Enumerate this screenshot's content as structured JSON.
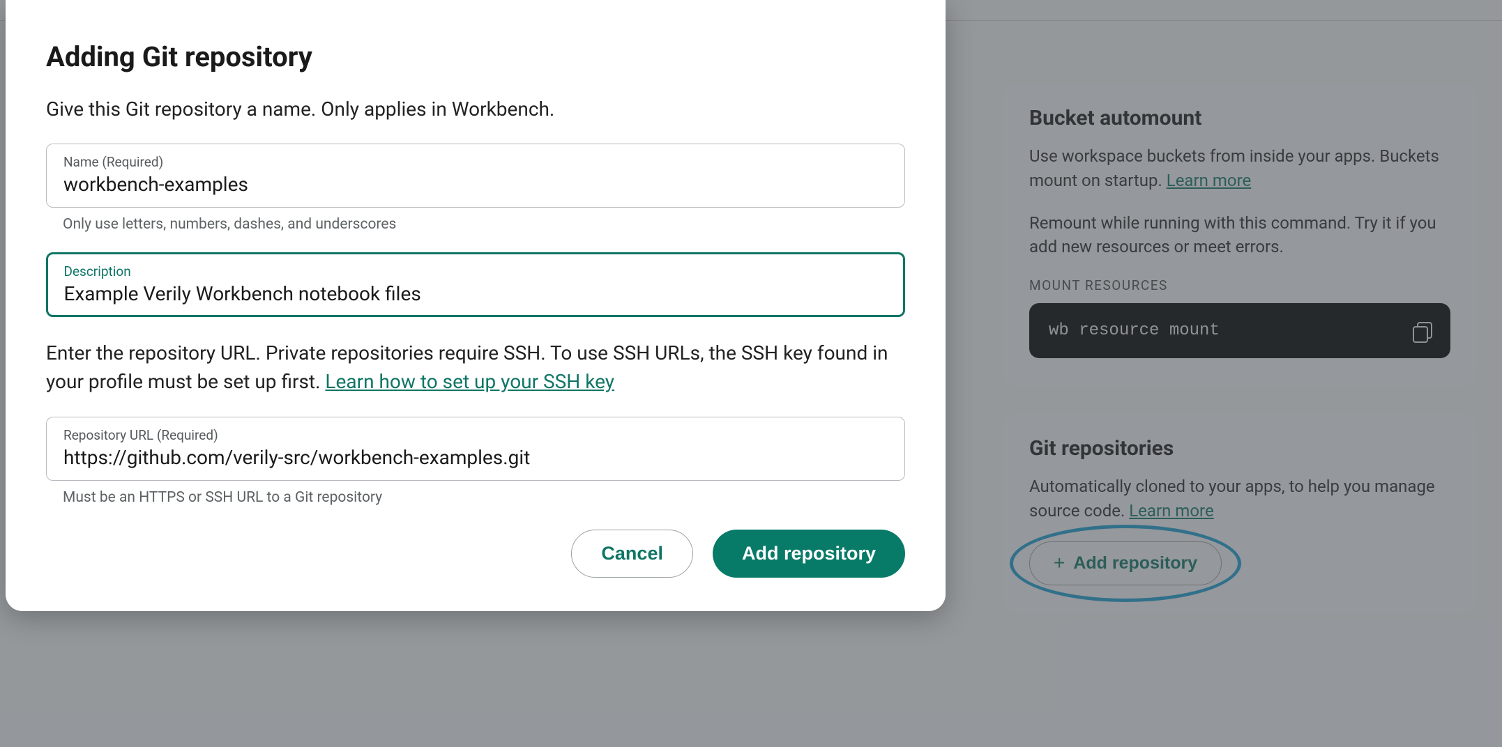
{
  "background": {
    "bucket_card": {
      "title": "Bucket automount",
      "p1_prefix": "Use workspace buckets from inside your apps. Buckets mount on startup. ",
      "learn_more": "Learn more",
      "p2": "Remount while running with this command. Try it if you add new resources or meet errors.",
      "section_label": "MOUNT RESOURCES",
      "command": "wb resource mount"
    },
    "git_card": {
      "title": "Git repositories",
      "desc_prefix": "Automatically cloned to your apps, to help you manage source code. ",
      "learn_more": "Learn more",
      "add_button": "Add repository"
    }
  },
  "modal": {
    "title": "Adding Git repository",
    "intro": "Give this Git repository a name. Only applies in Workbench.",
    "name_field": {
      "label": "Name (Required)",
      "value": "workbench-examples",
      "helper": "Only use letters, numbers, dashes, and underscores"
    },
    "description_field": {
      "label": "Description",
      "value": "Example Verily Workbench notebook files"
    },
    "url_intro_prefix": "Enter the repository URL. Private repositories require SSH. To use SSH URLs, the SSH key found in your profile must be set up first. ",
    "url_intro_link": "Learn how to set up your SSH key",
    "url_field": {
      "label": "Repository URL (Required)",
      "value": "https://github.com/verily-src/workbench-examples.git",
      "helper": "Must be an HTTPS or SSH URL to a Git repository"
    },
    "actions": {
      "cancel": "Cancel",
      "submit": "Add repository"
    }
  }
}
